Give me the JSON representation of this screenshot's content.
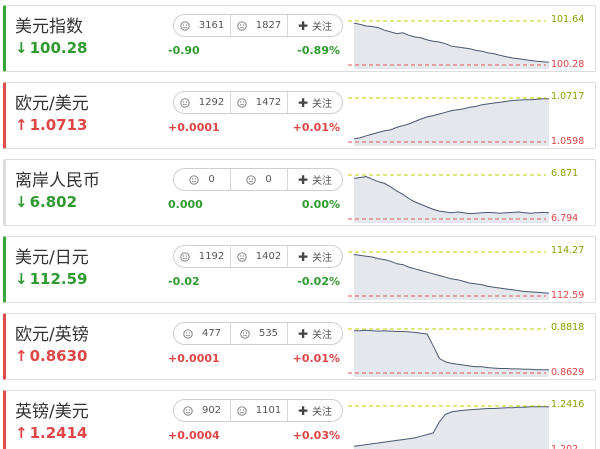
{
  "instruments": [
    {
      "name": "美元指数",
      "price": "100.28",
      "direction": "down",
      "change": "-0.90",
      "pct": "-0.89%",
      "bullish": "3161",
      "bearish": "1827",
      "follow_label": "关注",
      "high_ref": "101.64",
      "low_ref": "100.28",
      "spark": [
        0.95,
        0.92,
        0.88,
        0.87,
        0.84,
        0.78,
        0.74,
        0.7,
        0.72,
        0.66,
        0.62,
        0.6,
        0.55,
        0.52,
        0.5,
        0.46,
        0.4,
        0.38,
        0.36,
        0.34,
        0.3,
        0.28,
        0.24,
        0.22,
        0.18,
        0.15,
        0.12,
        0.1,
        0.08,
        0.06,
        0.04,
        0.03,
        0.02
      ]
    },
    {
      "name": "欧元/美元",
      "price": "1.0713",
      "direction": "up",
      "change": "+0.0001",
      "pct": "+0.01%",
      "bullish": "1292",
      "bearish": "1472",
      "follow_label": "关注",
      "high_ref": "1.0717",
      "low_ref": "1.0598",
      "spark": [
        0.03,
        0.05,
        0.1,
        0.14,
        0.18,
        0.22,
        0.24,
        0.3,
        0.34,
        0.38,
        0.44,
        0.5,
        0.55,
        0.58,
        0.62,
        0.66,
        0.7,
        0.72,
        0.74,
        0.78,
        0.8,
        0.84,
        0.86,
        0.88,
        0.9,
        0.92,
        0.94,
        0.95,
        0.96,
        0.96,
        0.97,
        0.98,
        0.98
      ]
    },
    {
      "name": "离岸人民币",
      "price": "6.802",
      "direction": "flat",
      "change": "0.000",
      "pct": "0.00%",
      "bullish": "0",
      "bearish": "0",
      "follow_label": "关注",
      "high_ref": "6.871",
      "low_ref": "6.794",
      "spark": [
        0.92,
        0.94,
        0.96,
        0.9,
        0.84,
        0.8,
        0.72,
        0.62,
        0.54,
        0.44,
        0.36,
        0.3,
        0.24,
        0.18,
        0.14,
        0.12,
        0.1,
        0.12,
        0.1,
        0.08,
        0.09,
        0.1,
        0.11,
        0.1,
        0.09,
        0.1,
        0.11,
        0.12,
        0.1,
        0.09,
        0.1,
        0.11,
        0.1
      ]
    },
    {
      "name": "美元/日元",
      "price": "112.59",
      "direction": "down",
      "change": "-0.02",
      "pct": "-0.02%",
      "bullish": "1192",
      "bearish": "1402",
      "follow_label": "关注",
      "high_ref": "114.27",
      "low_ref": "112.59",
      "spark": [
        0.94,
        0.92,
        0.9,
        0.88,
        0.84,
        0.82,
        0.78,
        0.72,
        0.7,
        0.64,
        0.6,
        0.56,
        0.52,
        0.48,
        0.44,
        0.4,
        0.36,
        0.34,
        0.3,
        0.26,
        0.24,
        0.22,
        0.18,
        0.16,
        0.14,
        0.12,
        0.1,
        0.08,
        0.06,
        0.05,
        0.04,
        0.03,
        0.02
      ]
    },
    {
      "name": "欧元/英镑",
      "price": "0.8630",
      "direction": "up",
      "change": "+0.0001",
      "pct": "+0.01%",
      "bullish": "477",
      "bearish": "535",
      "follow_label": "关注",
      "high_ref": "0.8818",
      "low_ref": "0.8629",
      "spark": [
        0.96,
        0.96,
        0.97,
        0.96,
        0.95,
        0.96,
        0.95,
        0.94,
        0.94,
        0.93,
        0.92,
        0.9,
        0.88,
        0.6,
        0.3,
        0.22,
        0.18,
        0.16,
        0.14,
        0.12,
        0.1,
        0.1,
        0.08,
        0.07,
        0.06,
        0.06,
        0.05,
        0.05,
        0.04,
        0.04,
        0.03,
        0.03,
        0.03
      ]
    },
    {
      "name": "英镑/美元",
      "price": "1.2414",
      "direction": "up",
      "change": "+0.0004",
      "pct": "+0.03%",
      "bullish": "902",
      "bearish": "1101",
      "follow_label": "关注",
      "high_ref": "1.2416",
      "low_ref": "1.202",
      "spark": [
        0.04,
        0.06,
        0.08,
        0.1,
        0.12,
        0.14,
        0.16,
        0.18,
        0.2,
        0.22,
        0.24,
        0.28,
        0.32,
        0.36,
        0.62,
        0.8,
        0.86,
        0.88,
        0.9,
        0.91,
        0.92,
        0.93,
        0.94,
        0.94,
        0.95,
        0.96,
        0.96,
        0.97,
        0.97,
        0.98,
        0.98,
        0.98,
        0.98
      ]
    }
  ],
  "colors": {
    "up": "#e04545",
    "down": "#2f9a2f",
    "hi_line": "#c6d200",
    "lo_line": "#e05a5a"
  }
}
